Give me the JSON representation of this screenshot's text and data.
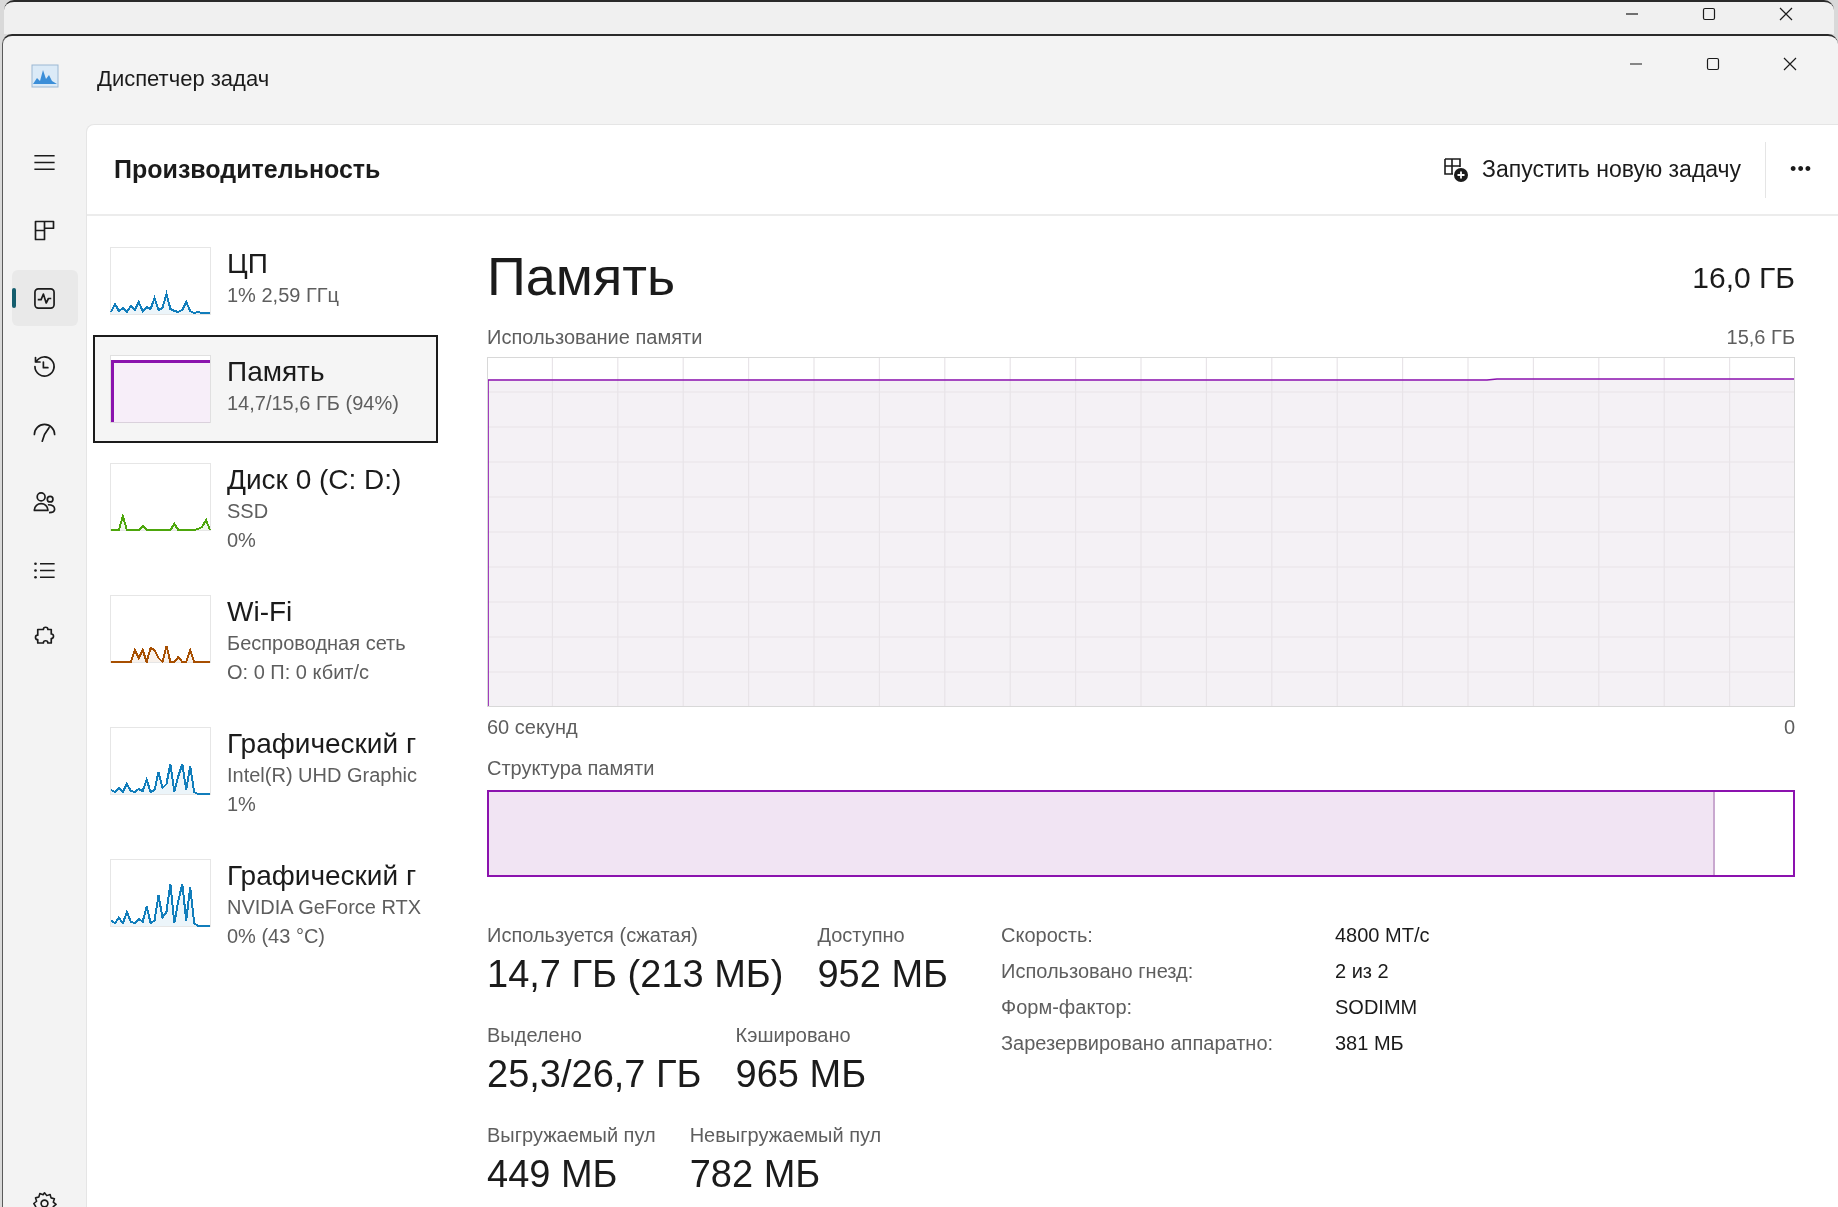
{
  "window": {
    "title": "Диспетчер задач"
  },
  "nav": [
    {
      "kind": "menu",
      "selected": false
    },
    {
      "kind": "processes",
      "selected": false
    },
    {
      "kind": "performance",
      "selected": true
    },
    {
      "kind": "history",
      "selected": false
    },
    {
      "kind": "startup",
      "selected": false
    },
    {
      "kind": "users",
      "selected": false
    },
    {
      "kind": "details",
      "selected": false
    },
    {
      "kind": "services",
      "selected": false
    }
  ],
  "header": {
    "title": "Производительность",
    "run_task_button": "Запустить новую задачу",
    "more_button": "•••"
  },
  "devices": [
    {
      "kind": "cpu",
      "color": "#117dbb",
      "selected": false,
      "title": "ЦП",
      "lines": [
        "1% 2,59 ГГц"
      ]
    },
    {
      "kind": "memory",
      "color": "#8b12ae",
      "selected": true,
      "title": "Память",
      "lines": [
        "14,7/15,6 ГБ (94%)"
      ]
    },
    {
      "kind": "disk",
      "color": "#4da60c",
      "selected": false,
      "title": "Диск 0 (C: D:)",
      "lines": [
        "SSD",
        "0%"
      ]
    },
    {
      "kind": "network",
      "color": "#a74f01",
      "selected": false,
      "title": "Wi-Fi",
      "lines": [
        "Беспроводная сеть",
        "О: 0 П: 0 кбит/с"
      ]
    },
    {
      "kind": "gpu",
      "color": "#117dbb",
      "selected": false,
      "title": "Графический г",
      "lines": [
        "Intel(R) UHD Graphic",
        "1%"
      ]
    },
    {
      "kind": "gpu",
      "color": "#117dbb",
      "selected": false,
      "title": "Графический г",
      "lines": [
        "NVIDIA GeForce RTX",
        "0% (43 °C)"
      ]
    }
  ],
  "detail": {
    "title": "Память",
    "total": "16,0 ГБ",
    "graph_label": "Использование памяти",
    "graph_max": "15,6 ГБ",
    "graph_span": "60 секунд",
    "graph_min": "0",
    "composition_label": "Структура памяти",
    "composition": {
      "level": 0.94
    },
    "stat_rows": [
      {
        "items": [
          {
            "label": "Используется (сжатая)",
            "value": "14,7 ГБ (213 МБ)"
          },
          {
            "label": "Доступно",
            "value": "952 МБ"
          }
        ]
      },
      {
        "items": [
          {
            "label": "Выделено",
            "value": "25,3/26,7 ГБ"
          },
          {
            "label": "Кэшировано",
            "value": "965 МБ"
          }
        ]
      },
      {
        "items": [
          {
            "label": "Выгружаемый пул",
            "value": "449 МБ"
          },
          {
            "label": "Невыгружаемый пул",
            "value": "782 МБ"
          }
        ]
      }
    ],
    "properties": [
      {
        "label": "Скорость:",
        "value": "4800 МТ/с"
      },
      {
        "label": "Использовано гнезд:",
        "value": "2 из 2"
      },
      {
        "label": "Форм-фактор:",
        "value": "SODIMM"
      },
      {
        "label": "Зарезервировано аппаратно:",
        "value": "381 МБ"
      }
    ]
  }
}
